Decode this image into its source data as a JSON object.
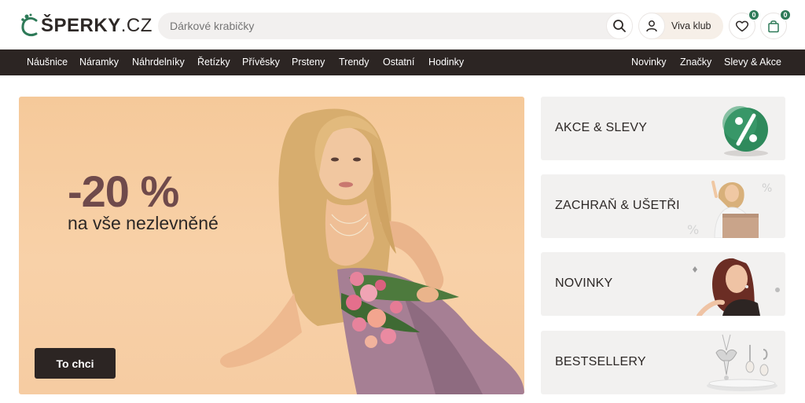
{
  "header": {
    "logo_main": "ŠPERKY",
    "logo_suffix": ".CZ",
    "search": {
      "value": "",
      "placeholder": "Dárkové krabičky"
    },
    "viva_label": "Viva klub",
    "wishlist_count": "0",
    "cart_count": "0"
  },
  "nav": {
    "left": [
      "Náušnice",
      "Náramky",
      "Náhrdelníky",
      "Řetízky",
      "Přívěsky",
      "Prsteny",
      "Trendy",
      "Ostatní",
      "Hodinky"
    ],
    "right": [
      "Novinky",
      "Značky",
      "Slevy & Akce"
    ]
  },
  "hero": {
    "discount": "-20 %",
    "subtitle": "na vše nezlevněné",
    "cta": "To chci"
  },
  "tiles": [
    {
      "label": "AKCE & SLEVY"
    },
    {
      "label": "ZACHRAŇ & UŠETŘI"
    },
    {
      "label": "NOVINKY"
    },
    {
      "label": "BESTSELLERY"
    }
  ],
  "colors": {
    "nav_bg": "#2c2523",
    "accent_green": "#2e7a58",
    "hero_bg": "#f5c99a",
    "discount_text": "#6f4a4b",
    "tile_bg": "#f2f1f0"
  }
}
